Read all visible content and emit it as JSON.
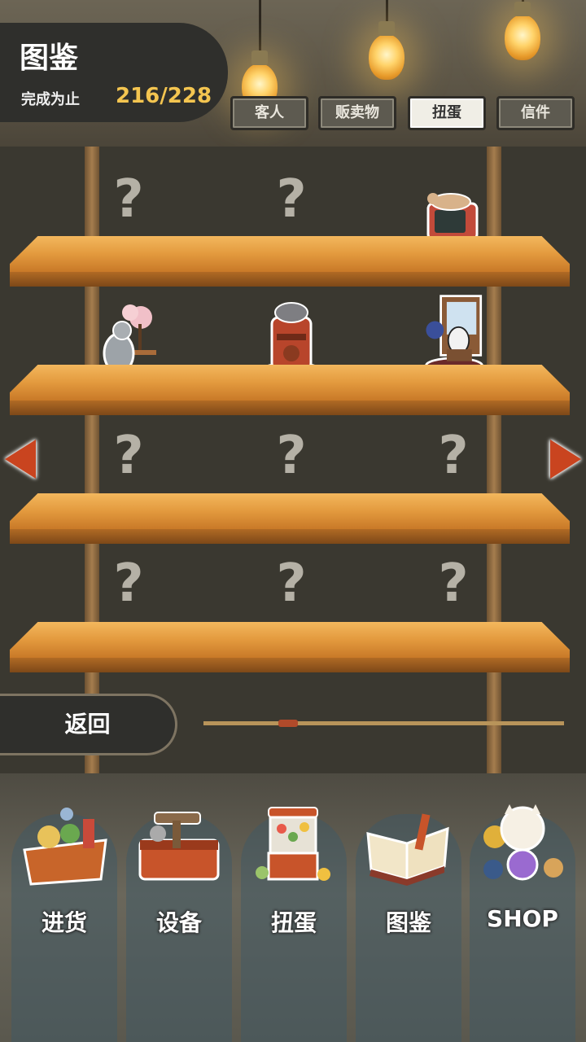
{
  "header": {
    "title": "图鉴",
    "progress_label": "完成为止",
    "progress_value": "216/228"
  },
  "tabs": [
    {
      "label": "客人",
      "active": false
    },
    {
      "label": "贩卖物",
      "active": false
    },
    {
      "label": "扭蛋",
      "active": true
    },
    {
      "label": "信件",
      "active": false
    }
  ],
  "shelf": {
    "unknown_mark": "?",
    "rows": [
      [
        "unknown",
        "unknown",
        "cat-on-tv-figure"
      ],
      [
        "cat-with-cherry-tree-figure",
        "cat-in-mailbox-figure",
        "cow-cat-window-figure"
      ],
      [
        "unknown",
        "unknown",
        "unknown"
      ],
      [
        "unknown",
        "unknown",
        "unknown"
      ]
    ]
  },
  "footer": {
    "back_label": "返回"
  },
  "nav": [
    {
      "label": "进货",
      "icon": "goods-basket-icon"
    },
    {
      "label": "设备",
      "icon": "toolbox-icon"
    },
    {
      "label": "扭蛋",
      "icon": "gacha-machine-icon"
    },
    {
      "label": "图鉴",
      "icon": "catalog-book-icon"
    },
    {
      "label": "SHOP",
      "icon": "lucky-cat-icon"
    }
  ],
  "colors": {
    "accent": "#f4c550",
    "arrow": "#c9441f",
    "shelf": "#e39a3e"
  }
}
